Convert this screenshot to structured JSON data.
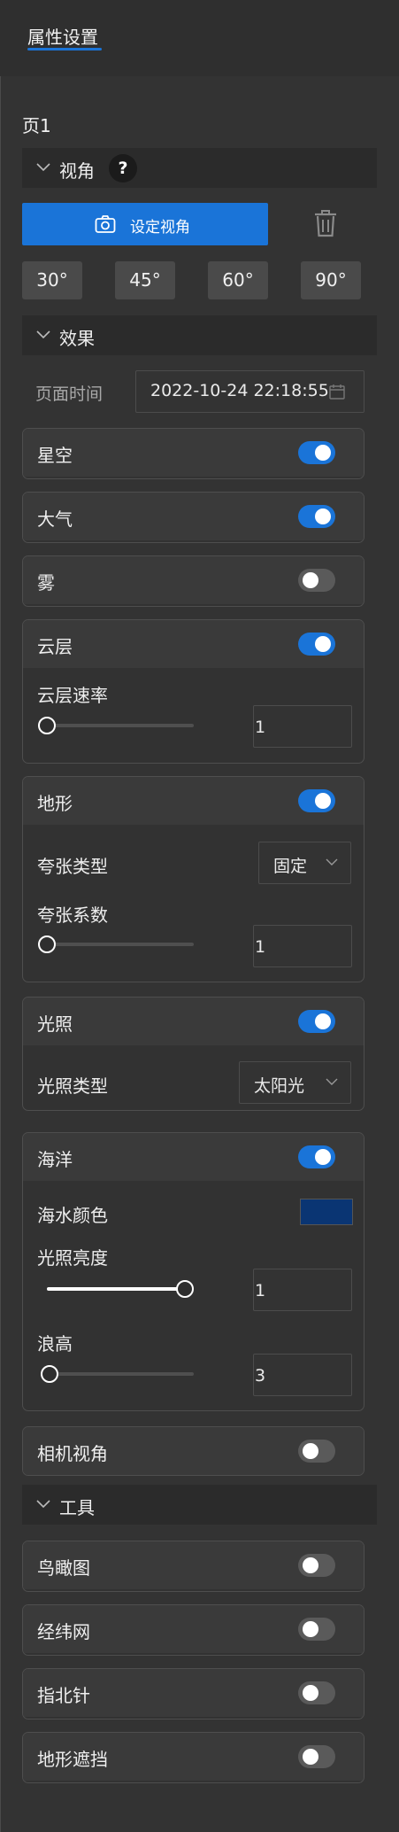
{
  "header": {
    "tab_title": "属性设置"
  },
  "page_label": "页1",
  "view_section": {
    "title": "视角",
    "help": "?",
    "set_view_label": "设定视角",
    "angles": [
      "30°",
      "45°",
      "60°",
      "90°"
    ]
  },
  "effects_section": {
    "title": "效果",
    "time_label": "页面时间",
    "time_value": "2022-10-24 22:18:55",
    "starry_sky": {
      "label": "星空",
      "on": true
    },
    "atmosphere": {
      "label": "大气",
      "on": true
    },
    "fog": {
      "label": "雾",
      "on": false
    },
    "clouds": {
      "label": "云层",
      "on": true,
      "speed_label": "云层速率",
      "speed_value": "1",
      "speed_fraction": 0.0
    },
    "terrain": {
      "label": "地形",
      "on": true,
      "exaggeration_type_label": "夸张类型",
      "exaggeration_type_value": "固定",
      "exaggeration_coef_label": "夸张系数",
      "exaggeration_coef_value": "1",
      "exaggeration_fraction": 0.0
    },
    "lighting": {
      "label": "光照",
      "on": true,
      "type_label": "光照类型",
      "type_value": "太阳光"
    },
    "ocean": {
      "label": "海洋",
      "on": true,
      "color_label": "海水颜色",
      "color_value": "#0a3573",
      "brightness_label": "光照亮度",
      "brightness_value": "1",
      "brightness_fraction": 1.0,
      "wave_label": "浪高",
      "wave_value": "3",
      "wave_fraction": 0.02
    },
    "camera_view": {
      "label": "相机视角",
      "on": false
    }
  },
  "tools_section": {
    "title": "工具",
    "birds_eye": {
      "label": "鸟瞰图",
      "on": false
    },
    "graticule": {
      "label": "经纬网",
      "on": false
    },
    "compass": {
      "label": "指北针",
      "on": false
    },
    "terrain_occlusion": {
      "label": "地形遮挡",
      "on": false
    }
  },
  "colors": {
    "accent": "#1a74d8",
    "background": "#333333",
    "ocean_color": "#0a3573"
  }
}
